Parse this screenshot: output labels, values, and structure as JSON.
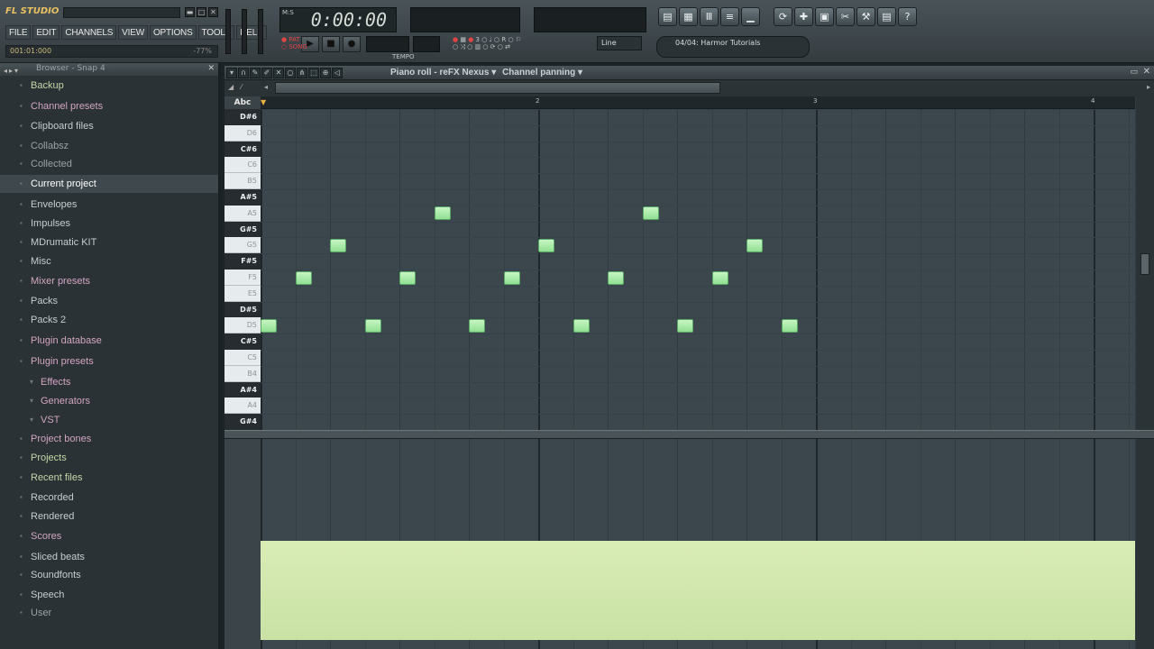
{
  "app": {
    "logo": "FL STUDIO",
    "menu": [
      "FILE",
      "EDIT",
      "CHANNELS",
      "VIEW",
      "OPTIONS",
      "TOOLS",
      "HELP"
    ],
    "hint_left": "001:01:000",
    "hint_right": "-77%",
    "time": "0:00:00",
    "snap_mode": "Line",
    "pattern_name": "04/04: Harmor Tutorials",
    "tempo_label": "TEMPO"
  },
  "browser": {
    "title": "Browser - Snap 4",
    "items": [
      {
        "label": "Backup",
        "style": "green"
      },
      {
        "label": "Channel presets",
        "style": "pink"
      },
      {
        "label": "Clipboard files",
        "style": "normal"
      },
      {
        "label": "Collabsz",
        "style": "dim"
      },
      {
        "label": "Collected",
        "style": "dim"
      },
      {
        "label": "Current project",
        "style": "sel"
      },
      {
        "label": "Envelopes",
        "style": "normal"
      },
      {
        "label": "Impulses",
        "style": "normal"
      },
      {
        "label": "MDrumatic KIT",
        "style": "normal"
      },
      {
        "label": "Misc",
        "style": "normal"
      },
      {
        "label": "Mixer presets",
        "style": "pink"
      },
      {
        "label": "Packs",
        "style": "normal"
      },
      {
        "label": "Packs 2",
        "style": "normal"
      },
      {
        "label": "Plugin database",
        "style": "pink"
      },
      {
        "label": "Plugin presets",
        "style": "pink"
      },
      {
        "label": "Effects",
        "style": "pink",
        "sub": true
      },
      {
        "label": "Generators",
        "style": "pink",
        "sub": true
      },
      {
        "label": "VST",
        "style": "pink",
        "sub": true
      },
      {
        "label": "Project bones",
        "style": "pink"
      },
      {
        "label": "Projects",
        "style": "green"
      },
      {
        "label": "Recent files",
        "style": "green"
      },
      {
        "label": "Recorded",
        "style": "normal"
      },
      {
        "label": "Rendered",
        "style": "normal"
      },
      {
        "label": "Scores",
        "style": "pink"
      },
      {
        "label": "Sliced beats",
        "style": "normal"
      },
      {
        "label": "Soundfonts",
        "style": "normal"
      },
      {
        "label": "Speech",
        "style": "normal"
      },
      {
        "label": "User",
        "style": "dim"
      }
    ]
  },
  "pianoroll": {
    "title": "Piano roll - reFX Nexus",
    "target": "Channel panning",
    "abc": "Abc",
    "bar_numbers": [
      "2",
      "3",
      "4"
    ],
    "keys": [
      {
        "label": "D#6",
        "black": true
      },
      {
        "label": "D6",
        "black": false
      },
      {
        "label": "C#6",
        "black": true
      },
      {
        "label": "C6",
        "black": false
      },
      {
        "label": "B5",
        "black": false
      },
      {
        "label": "A#5",
        "black": true
      },
      {
        "label": "A5",
        "black": false
      },
      {
        "label": "G#5",
        "black": true
      },
      {
        "label": "G5",
        "black": false
      },
      {
        "label": "F#5",
        "black": true
      },
      {
        "label": "F5",
        "black": false
      },
      {
        "label": "E5",
        "black": false
      },
      {
        "label": "D#5",
        "black": true
      },
      {
        "label": "D5",
        "black": false
      },
      {
        "label": "C#5",
        "black": true
      },
      {
        "label": "C5",
        "black": false
      },
      {
        "label": "B4",
        "black": false
      },
      {
        "label": "A#4",
        "black": true
      },
      {
        "label": "A4",
        "black": false
      },
      {
        "label": "G#4",
        "black": true
      }
    ],
    "notes": [
      {
        "step": 0,
        "key": "D5"
      },
      {
        "step": 1,
        "key": "F5"
      },
      {
        "step": 2,
        "key": "G5"
      },
      {
        "step": 3,
        "key": "D5"
      },
      {
        "step": 4,
        "key": "F5"
      },
      {
        "step": 5,
        "key": "A5"
      },
      {
        "step": 6,
        "key": "D5"
      },
      {
        "step": 7,
        "key": "F5"
      },
      {
        "step": 8,
        "key": "G5"
      },
      {
        "step": 9,
        "key": "D5"
      },
      {
        "step": 10,
        "key": "F5"
      },
      {
        "step": 11,
        "key": "A5"
      },
      {
        "step": 12,
        "key": "D5"
      },
      {
        "step": 13,
        "key": "F5"
      },
      {
        "step": 14,
        "key": "G5"
      },
      {
        "step": 15,
        "key": "D5"
      }
    ],
    "event_level": 0.5
  }
}
